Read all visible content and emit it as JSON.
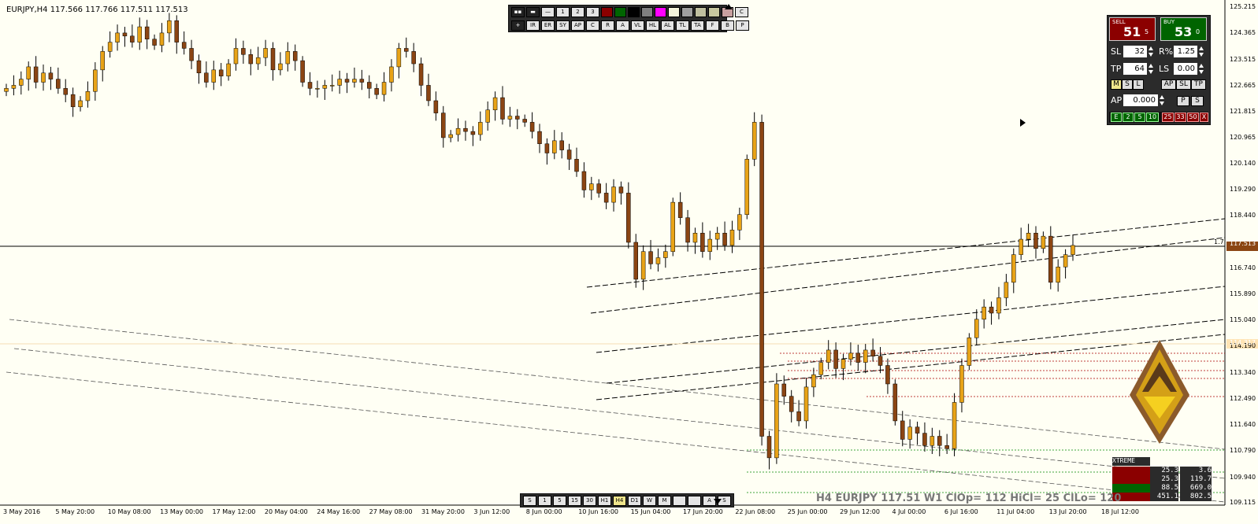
{
  "header": {
    "title": "EURJPY,H4  117.566 117.766 117.511 117.513"
  },
  "top_toolbar": {
    "row1": [
      "—",
      "1",
      "2",
      "3"
    ],
    "row1_colors": [
      "#8b0000",
      "#006400",
      "#000000",
      "#808080",
      "#ff00ff",
      "#f5f5dc",
      "#a0a0a0",
      "#c0c0a0",
      "#c8c8a0",
      "#c8a0a0"
    ],
    "row1_end": "C",
    "row2": [
      "IR",
      "ER",
      "SY",
      "AP",
      "C",
      "R",
      "A",
      "VL",
      "HL",
      "AL",
      "TL",
      "TA",
      "F",
      "B",
      "P"
    ]
  },
  "timeframe_bar": [
    "S",
    "1",
    "5",
    "15",
    "30",
    "H1",
    "H4",
    "D1",
    "W",
    "M",
    "",
    "",
    "A",
    "S"
  ],
  "price_axis": {
    "labels": [
      "125.215",
      "124.365",
      "123.515",
      "122.665",
      "121.815",
      "120.965",
      "120.140",
      "119.290",
      "118.440",
      "117.513",
      "116.740",
      "115.890",
      "115.040",
      "114.190",
      "113.340",
      "112.490",
      "111.640",
      "110.790",
      "109.940",
      "109.115"
    ],
    "current_price": "117.513",
    "highlight_price": "114.317",
    "line_label": "1.7"
  },
  "time_axis": {
    "labels": [
      "3 May 2016",
      "5 May 20:00",
      "10 May 08:00",
      "13 May 00:00",
      "17 May 12:00",
      "20 May 04:00",
      "24 May 16:00",
      "27 May 08:00",
      "31 May 20:00",
      "3 Jun 12:00",
      "8 Jun 00:00",
      "10 Jun 16:00",
      "15 Jun 04:00",
      "17 Jun 20:00",
      "22 Jun 08:00",
      "25 Jun 00:00",
      "29 Jun 12:00",
      "4 Jul 00:00",
      "6 Jul 16:00",
      "11 Jul 04:00",
      "13 Jul 20:00",
      "18 Jul 12:00"
    ]
  },
  "trade_panel": {
    "sell_label": "SELL",
    "sell_big": "51",
    "sell_small": "5",
    "buy_label": "BUY",
    "buy_big": "53",
    "buy_small": "0",
    "sl_label": "SL",
    "sl_value": "32",
    "risk_label": "R%",
    "risk_value": "1.25",
    "tp_label": "TP",
    "tp_value": "64",
    "ls_label": "LS",
    "ls_value": "0.00",
    "mode_buttons": [
      "M",
      "S",
      "L"
    ],
    "action_buttons": [
      "AP",
      "SL",
      "TP"
    ],
    "ap_label": "AP",
    "ap_value": "0.000",
    "ap_buttons": [
      "P",
      "S"
    ],
    "bottom_green": [
      "E",
      "2",
      "5",
      "10"
    ],
    "bottom_red": [
      "25",
      "33",
      "50",
      "X"
    ]
  },
  "extreme_table": {
    "title": "XTREME",
    "rows": [
      {
        "a": "25.3",
        "b": "3.6",
        "color": "#8b0000"
      },
      {
        "a": "25.3",
        "b": "119.7",
        "color": "#8b0000"
      },
      {
        "a": "88.5",
        "b": "669.0",
        "color": "#006400"
      },
      {
        "a": "451.1",
        "b": "802.5",
        "color": "#8b0000"
      }
    ]
  },
  "info_bar": {
    "text": "H4 EURJPY 117.51 W1 ClOp= 112 HiCl= 25 ClLo= 120"
  },
  "chart_data": {
    "type": "candlestick",
    "symbol": "EURJPY",
    "timeframe": "H4",
    "ylim": [
      109.115,
      125.215
    ],
    "closes": [
      122.6,
      122.7,
      122.9,
      123.3,
      122.8,
      123.1,
      122.9,
      122.6,
      122.4,
      122.0,
      122.2,
      122.5,
      123.2,
      123.8,
      124.1,
      124.4,
      124.3,
      124.1,
      124.6,
      124.2,
      124.0,
      124.4,
      124.8,
      124.1,
      123.9,
      123.5,
      123.1,
      122.8,
      123.2,
      123.0,
      123.4,
      123.9,
      123.7,
      123.4,
      123.6,
      123.9,
      123.2,
      123.4,
      123.8,
      123.5,
      122.8,
      122.6,
      122.6,
      122.7,
      122.7,
      122.9,
      122.8,
      122.9,
      122.8,
      122.6,
      122.4,
      122.8,
      123.3,
      123.9,
      123.8,
      123.4,
      122.7,
      122.2,
      121.8,
      121.0,
      121.1,
      121.3,
      121.2,
      121.1,
      121.5,
      121.9,
      122.3,
      121.6,
      121.7,
      121.6,
      121.5,
      121.2,
      120.8,
      120.5,
      120.9,
      120.6,
      120.3,
      119.9,
      119.3,
      119.5,
      119.2,
      118.9,
      119.4,
      119.2,
      117.6,
      116.4,
      117.3,
      116.9,
      117.1,
      117.3,
      118.9,
      118.4,
      117.6,
      117.9,
      117.3,
      117.7,
      117.9,
      117.5,
      118.0,
      118.5,
      120.3,
      121.5,
      111.3,
      110.6,
      113.0,
      112.6,
      112.1,
      111.8,
      112.9,
      113.3,
      113.7,
      114.1,
      113.5,
      113.8,
      114.0,
      113.7,
      114.1,
      113.9,
      113.6,
      113.0,
      111.8,
      111.2,
      111.6,
      111.4,
      111.0,
      111.3,
      111.0,
      110.9,
      112.4,
      113.6,
      114.5,
      115.1,
      115.5,
      115.3,
      115.8,
      116.3,
      117.2,
      117.7,
      117.9,
      117.4,
      117.8,
      116.3,
      116.8,
      117.2,
      117.5
    ]
  }
}
